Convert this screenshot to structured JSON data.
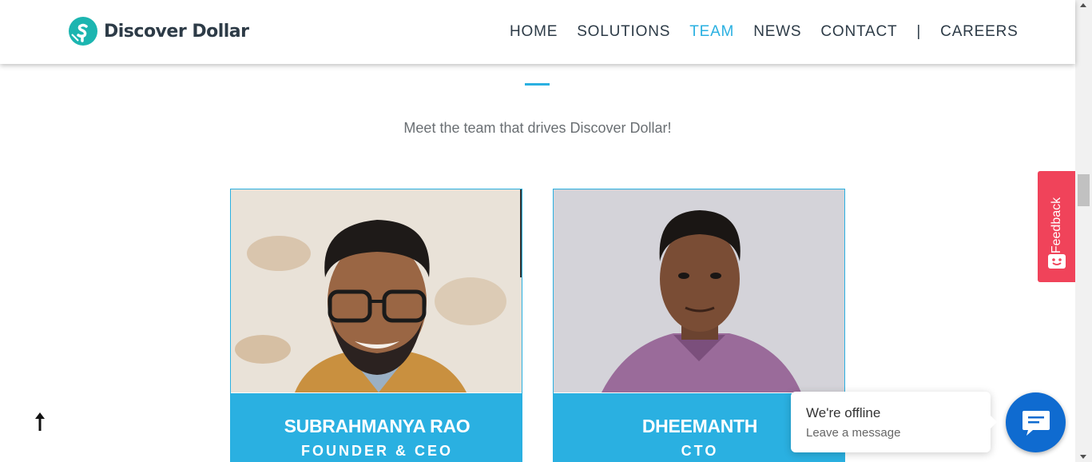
{
  "brand": {
    "name": "Discover Dollar",
    "accent": "#2ab0e1",
    "logo_color": "#1cb5b0"
  },
  "nav": {
    "items": [
      {
        "label": "HOME"
      },
      {
        "label": "SOLUTIONS"
      },
      {
        "label": "TEAM",
        "active": true
      },
      {
        "label": "NEWS"
      },
      {
        "label": "CONTACT"
      },
      {
        "label": "|"
      },
      {
        "label": "CAREERS"
      }
    ]
  },
  "section": {
    "subtitle": "Meet the team that drives Discover Dollar!"
  },
  "team": [
    {
      "name": "SUBRAHMANYA RAO",
      "role": "FOUNDER & CEO"
    },
    {
      "name": "DHEEMANTH",
      "role": "CTO"
    }
  ],
  "feedback": {
    "label": "Feedback",
    "color": "#f0435a"
  },
  "chat": {
    "status": "We're offline",
    "action": "Leave a message",
    "button_color": "#0f6bd0"
  },
  "icons": {
    "back_to_top": "arrow-up-icon",
    "chat": "chat-bubble-icon",
    "feedback": "smiley-icon"
  }
}
